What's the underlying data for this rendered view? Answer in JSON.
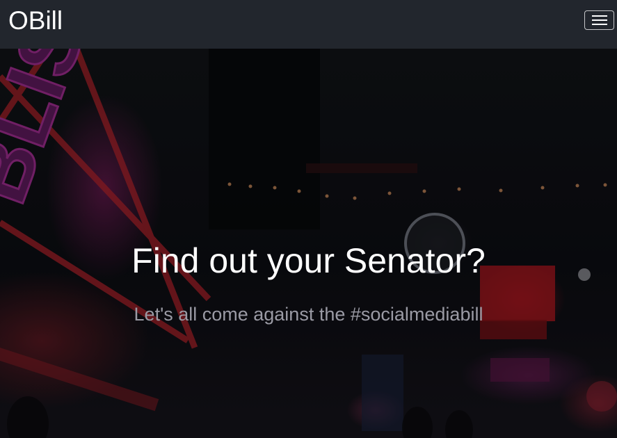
{
  "navbar": {
    "brand": "OBill",
    "toggle_icon": "hamburger-menu-icon"
  },
  "hero": {
    "headline": "Find out your Senator?",
    "subheadline": "Let's all come against the #socialmediabill",
    "background": "night street with neon signs",
    "accent_colors": [
      "#c2184f",
      "#7a1f6e",
      "#b3232a"
    ]
  }
}
